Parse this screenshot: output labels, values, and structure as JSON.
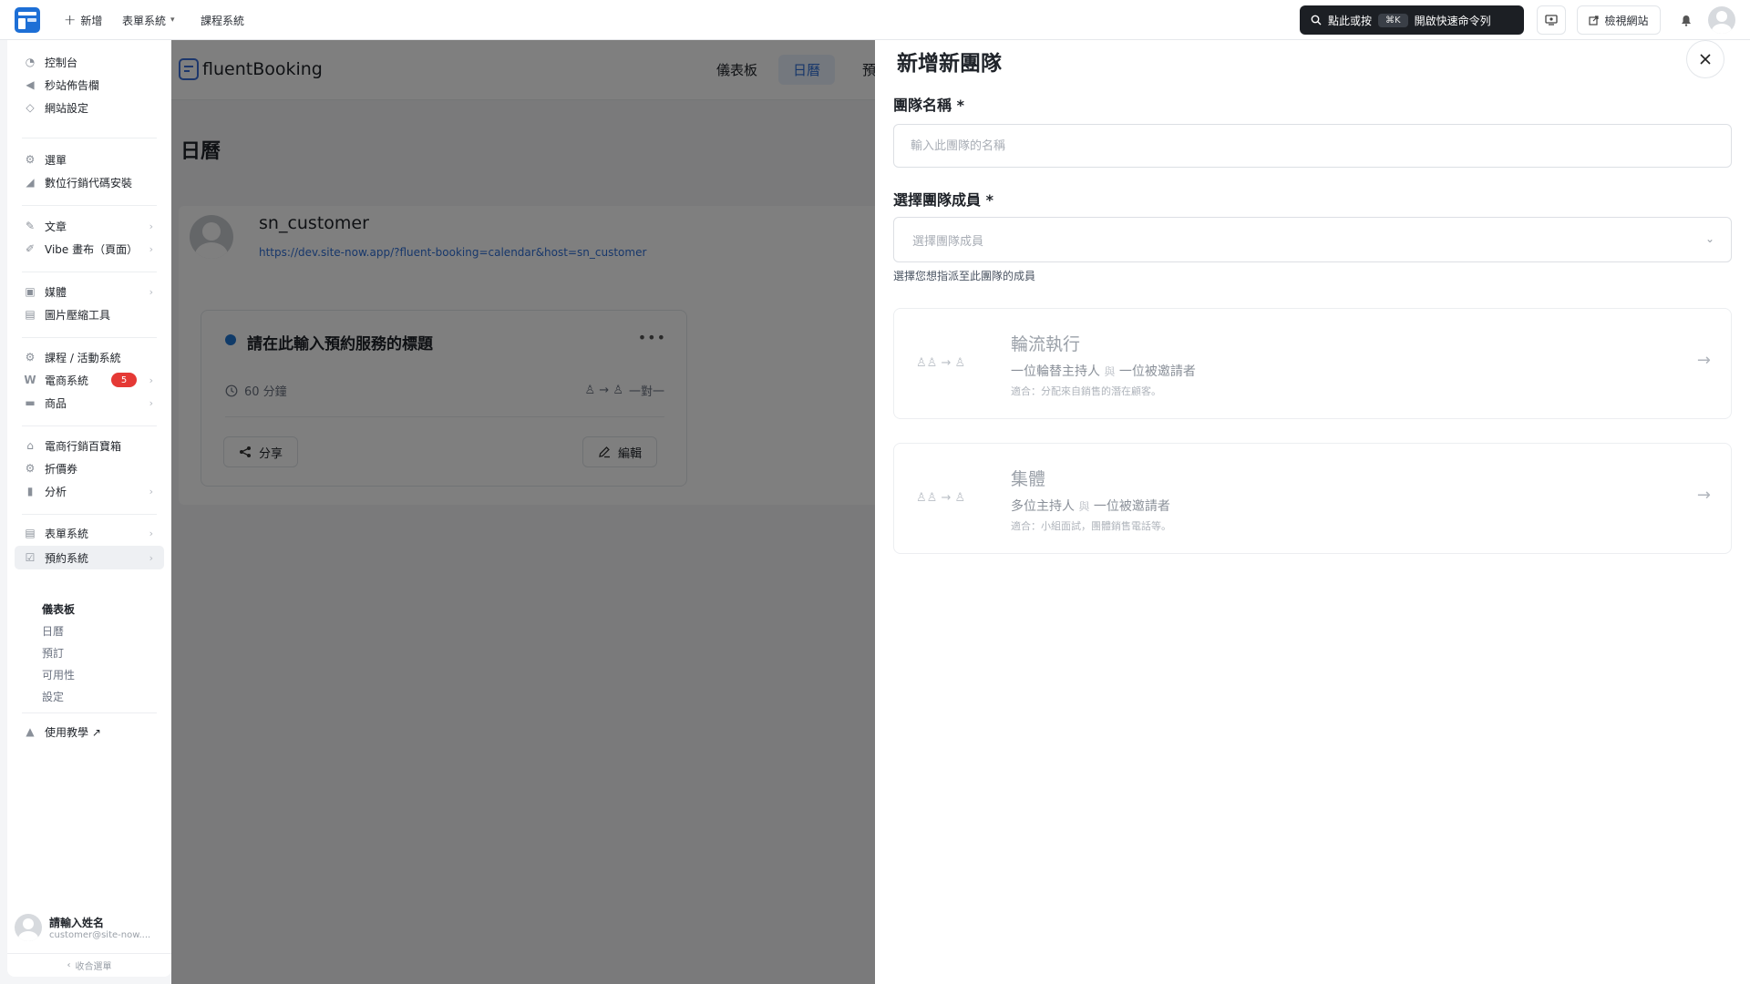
{
  "topbar": {
    "new_label": "新增",
    "forms_label": "表單系統",
    "courses_label": "課程系統",
    "cmdk_prefix": "點此或按",
    "cmdk_key": "⌘K",
    "cmdk_suffix": "開啟快速命令列",
    "view_site_label": "檢視網站"
  },
  "sidebar": {
    "items": [
      {
        "label": "控制台",
        "icon": "dashboard-icon"
      },
      {
        "label": "秒站佈告欄",
        "icon": "megaphone-icon"
      },
      {
        "label": "網站設定",
        "icon": "diamond-icon"
      },
      {
        "label": "選單",
        "icon": "gear-icon"
      },
      {
        "label": "數位行銷代碼安裝",
        "icon": "chart-icon"
      },
      {
        "label": "文章",
        "icon": "pin-icon"
      },
      {
        "label": "Vibe 畫布（頁面）",
        "icon": "brush-icon"
      },
      {
        "label": "媒體",
        "icon": "media-icon"
      },
      {
        "label": "圖片壓縮工具",
        "icon": "image-compress-icon"
      },
      {
        "label": "課程 / 活動系統",
        "icon": "gear-icon"
      },
      {
        "label": "電商系統",
        "icon": "woo-icon",
        "badge": "5"
      },
      {
        "label": "商品",
        "icon": "box-icon"
      },
      {
        "label": "電商行銷百寶箱",
        "icon": "store-icon"
      },
      {
        "label": "折價券",
        "icon": "gear-icon"
      },
      {
        "label": "分析",
        "icon": "bar-chart-icon"
      },
      {
        "label": "表單系統",
        "icon": "form-icon"
      },
      {
        "label": "預約系統",
        "icon": "booking-icon"
      },
      {
        "label": "使用教學 ↗",
        "icon": "graduation-icon"
      }
    ],
    "sub_items": [
      "儀表板",
      "日曆",
      "預訂",
      "可用性",
      "設定"
    ],
    "user_name": "請輸入姓名",
    "user_email": "customer@site-now....",
    "collapse_label": "收合選單"
  },
  "main": {
    "brand": "fluentBooking",
    "tabs": [
      "儀表板",
      "日曆",
      "預"
    ],
    "page_title": "日曆",
    "host_name": "sn_customer",
    "host_url": "https://dev.site-now.app/?fluent-booking=calendar&host=sn_customer",
    "event_title": "請在此輸入預約服務的標題",
    "event_duration": "60 分鐘",
    "event_type": "一對一",
    "share_label": "分享",
    "edit_label": "編輯"
  },
  "drawer": {
    "title": "新增新團隊",
    "team_name_label": "團隊名稱 *",
    "team_name_placeholder": "輸入此團隊的名稱",
    "members_label": "選擇團隊成員 *",
    "members_placeholder": "選擇團隊成員",
    "members_help": "選擇您想指派至此團隊的成員",
    "options": [
      {
        "title": "輪流執行",
        "desc_a": "一位輪替主持人",
        "and": "與",
        "desc_b": "一位被邀請者",
        "note": "適合：分配來自銷售的潛在顧客。"
      },
      {
        "title": "集體",
        "desc_a": "多位主持人",
        "and": "與",
        "desc_b": "一位被邀請者",
        "note": "適合：小組面試，團體銷售電話等。"
      }
    ]
  },
  "colors": {
    "accent": "#2f6fd6",
    "badge": "#e53935",
    "cmdk_bg": "#1c1f24"
  }
}
